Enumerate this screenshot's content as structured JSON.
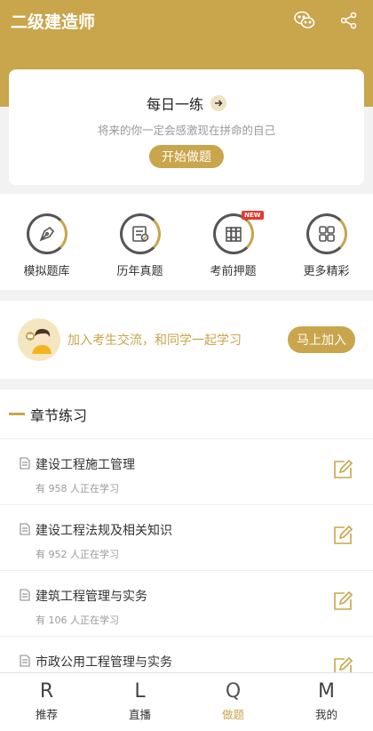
{
  "header": {
    "title": "二级建造师",
    "icons": [
      "wechat-icon",
      "share-icon"
    ]
  },
  "daily": {
    "title": "每日一练",
    "subtitle": "将来的你一定会感激现在拼命的自己",
    "button": "开始做题"
  },
  "actions": [
    {
      "label": "模拟题库",
      "icon": "pen-nib-icon"
    },
    {
      "label": "历年真题",
      "icon": "exam-paper-icon"
    },
    {
      "label": "考前押题",
      "icon": "books-icon",
      "badge": "NEW"
    },
    {
      "label": "更多精彩",
      "icon": "grid-icon"
    }
  ],
  "join": {
    "text": "加入考生交流，和同学一起学习",
    "button": "马上加入"
  },
  "chapters": {
    "title": "章节练习",
    "items": [
      {
        "name": "建设工程施工管理",
        "count": "有 958 人正在学习"
      },
      {
        "name": "建设工程法规及相关知识",
        "count": "有 952 人正在学习"
      },
      {
        "name": "建筑工程管理与实务",
        "count": "有 106 人正在学习"
      },
      {
        "name": "市政公用工程管理与实务",
        "count": ""
      }
    ]
  },
  "tabs": [
    {
      "glyph": "R",
      "label": "推荐"
    },
    {
      "glyph": "L",
      "label": "直播"
    },
    {
      "glyph": "Q",
      "label": "做题",
      "active": true
    },
    {
      "glyph": "M",
      "label": "我的"
    }
  ],
  "colors": {
    "accent": "#c9a54b",
    "badge": "#e23b2e"
  }
}
